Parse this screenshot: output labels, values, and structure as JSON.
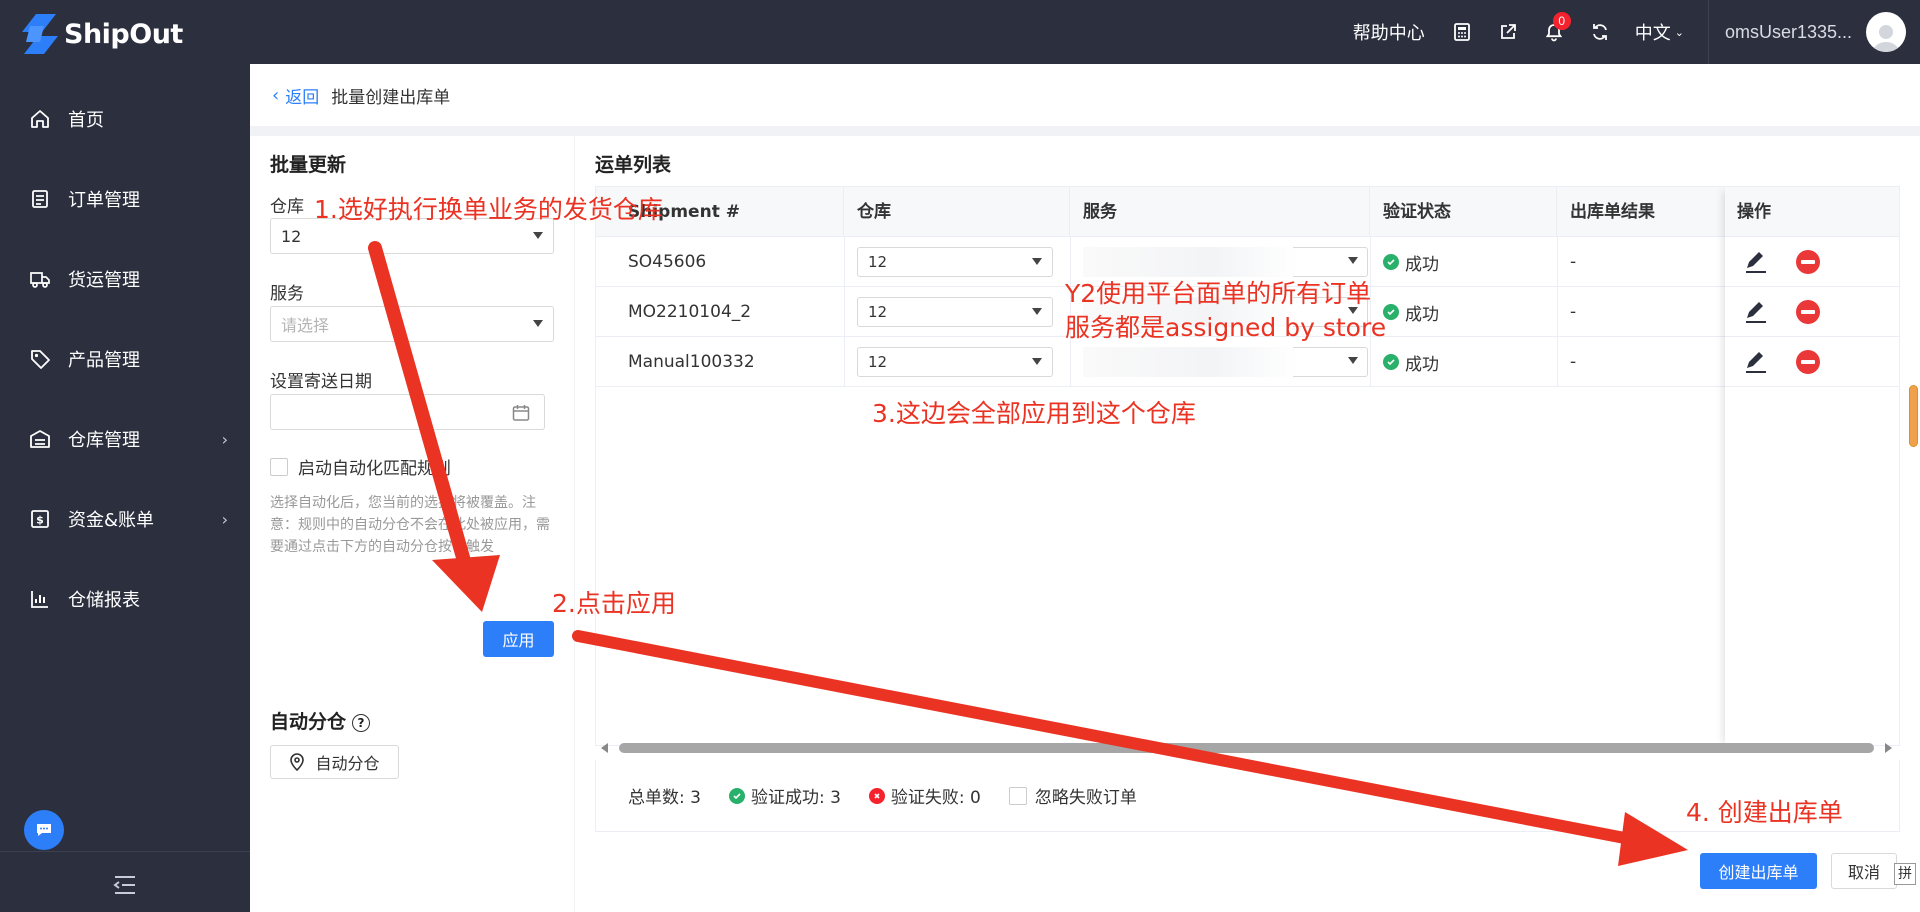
{
  "header": {
    "logo_text": "ShipOut",
    "help_center": "帮助中心",
    "notification_count": "0",
    "language": "中文",
    "username": "omsUser1335..."
  },
  "sidebar": {
    "items": [
      {
        "label": "首页",
        "icon": "home-icon"
      },
      {
        "label": "订单管理",
        "icon": "order-icon"
      },
      {
        "label": "货运管理",
        "icon": "truck-icon"
      },
      {
        "label": "产品管理",
        "icon": "tag-icon"
      },
      {
        "label": "仓库管理",
        "icon": "warehouse-icon",
        "has_submenu": true
      },
      {
        "label": "资金&账单",
        "icon": "finance-icon",
        "has_submenu": true
      },
      {
        "label": "仓储报表",
        "icon": "chart-icon"
      }
    ]
  },
  "breadcrumb": {
    "back_label": "返回",
    "title": "批量创建出库单"
  },
  "batch_update": {
    "title": "批量更新",
    "warehouse_label": "仓库",
    "warehouse_value": "12",
    "service_label": "服务",
    "service_placeholder": "请选择",
    "ship_date_label": "设置寄送日期",
    "auto_rule_label": "启动自动化匹配规则",
    "hint_text": "选择自动化后，您当前的选择将被覆盖。注意：规则中的自动分仓不会在此处被应用，需要通过点击下方的自动分仓按钮触发",
    "apply_button": "应用",
    "auto_assign_title": "自动分仓",
    "auto_assign_button": "自动分仓"
  },
  "shipment_list": {
    "title": "运单列表",
    "columns": [
      "Shipment #",
      "仓库",
      "服务",
      "验证状态",
      "出库单结果",
      "操作"
    ],
    "rows": [
      {
        "shipment": "SO45606",
        "warehouse": "12",
        "status": "成功",
        "result": "-"
      },
      {
        "shipment": "MO2210104_2",
        "warehouse": "12",
        "status": "成功",
        "result": "-"
      },
      {
        "shipment": "Manual100332",
        "warehouse": "12",
        "status": "成功",
        "result": "-"
      }
    ]
  },
  "summary": {
    "total": "总单数: 3",
    "success": "验证成功: 3",
    "failed": "验证失败: 0",
    "ignore_failed": "忽略失败订单"
  },
  "footer_buttons": {
    "create": "创建出库单",
    "cancel": "取消"
  },
  "ime_indicator": "拼",
  "annotations": {
    "step1": "1.选好执行换单业务的发货仓库",
    "step2": "2.点击应用",
    "step3": "3.这边会全部应用到这个仓库",
    "step4": "4. 创建出库单",
    "note_line1": "Y2使用平台面单的所有订单",
    "note_line2": "服务都是assigned by store"
  },
  "colors": {
    "primary": "#2d7ff9",
    "sidebar_bg": "#2b2f3e",
    "annotation_red": "#ea3323",
    "success_green": "#29b06b"
  }
}
